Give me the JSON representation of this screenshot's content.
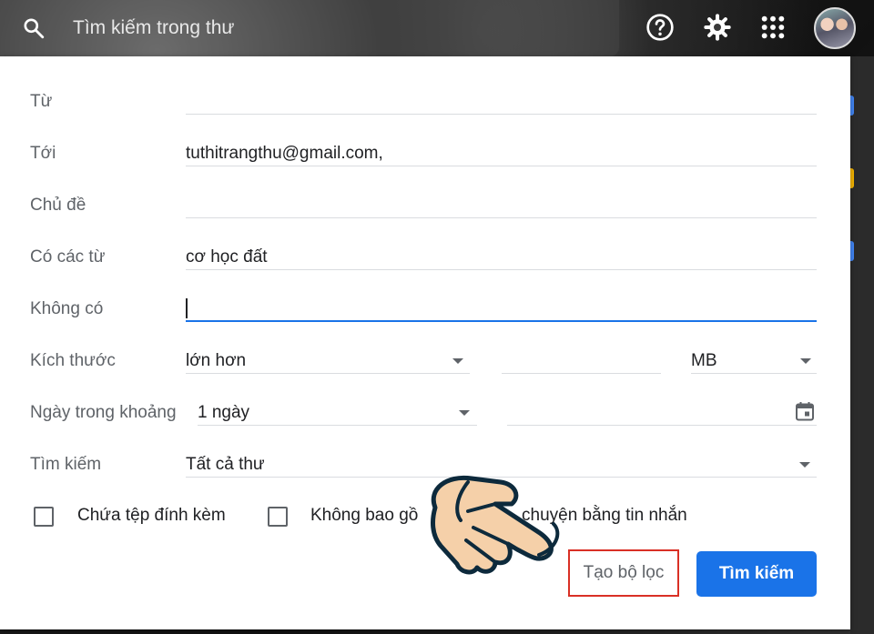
{
  "search": {
    "placeholder": "Tìm kiếm trong thư"
  },
  "header_icons": [
    "search-icon",
    "help-icon",
    "settings-icon",
    "apps-grid-icon",
    "avatar"
  ],
  "form": {
    "from": {
      "label": "Từ",
      "value": ""
    },
    "to": {
      "label": "Tới",
      "value": "tuthitrangthu@gmail.com,"
    },
    "subject": {
      "label": "Chủ đề",
      "value": ""
    },
    "has_words": {
      "label": "Có các từ",
      "value": "cơ học đất"
    },
    "doesnt_have": {
      "label": "Không có",
      "value": ""
    },
    "size": {
      "label": "Kích thước",
      "operator": "lớn hơn",
      "amount": "",
      "unit": "MB"
    },
    "date_within": {
      "label": "Ngày trong khoảng",
      "range": "1 ngày",
      "date": ""
    },
    "search_in": {
      "label": "Tìm kiếm",
      "value": "Tất cả thư"
    },
    "has_attachment": {
      "label": "Chứa tệp đính kèm",
      "checked": false
    },
    "exclude_chats": {
      "label_left": "Không bao gồ",
      "label_right": "chuyện bằng tin nhắn",
      "checked": false
    }
  },
  "buttons": {
    "create_filter": "Tạo bộ lọc",
    "search": "Tìm kiếm"
  },
  "colors": {
    "primary": "#1a73e8",
    "highlight_border": "#d93025",
    "hand_fill": "#f5d0a9"
  }
}
